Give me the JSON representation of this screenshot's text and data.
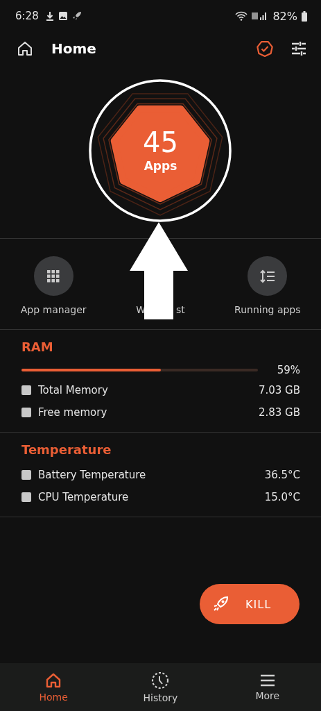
{
  "status_bar": {
    "time": "6:28",
    "battery": "82%"
  },
  "header": {
    "title": "Home"
  },
  "summary": {
    "count": "45",
    "label": "Apps"
  },
  "shortcuts": [
    {
      "kind": "grid",
      "label": "App manager"
    },
    {
      "label_parts": [
        "W",
        "st"
      ]
    },
    {
      "kind": "sort",
      "label": "Running apps"
    }
  ],
  "sections": [
    {
      "title": "RAM",
      "meter": {
        "level": 0.59,
        "reading": "59%"
      },
      "rows": [
        {
          "label": "Total Memory",
          "value": "7.03 GB",
          "checked": false
        },
        {
          "label": "Free memory",
          "value": "2.83 GB",
          "checked": false
        }
      ]
    },
    {
      "title": "Temperature",
      "rows": [
        {
          "label": "Battery Temperature",
          "value": "36.5°C",
          "checked": false
        },
        {
          "label": "CPU Temperature",
          "value": "15.0°C",
          "checked": false
        }
      ]
    }
  ],
  "kill_button": {
    "label": "KILL"
  },
  "bottom_nav": [
    {
      "kind": "home",
      "label": "Home",
      "selected": true
    },
    {
      "kind": "history",
      "label": "History",
      "selected": false
    },
    {
      "kind": "more",
      "label": "More",
      "selected": false
    }
  ]
}
